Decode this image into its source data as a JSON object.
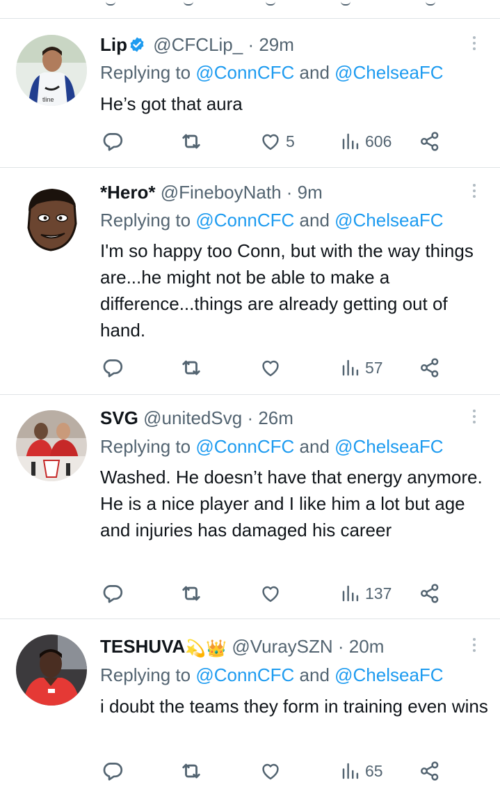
{
  "tweets": [
    {
      "name": "Lip",
      "verified": true,
      "handle": "@CFCLip_",
      "time": "· 29m",
      "replying_prefix": "Replying to ",
      "mention1": "@ConnCFC",
      "and": " and ",
      "mention2": "@ChelseaFC",
      "text": "He’s got that aura",
      "likes": "5",
      "views": "606"
    },
    {
      "name": "*Hero*",
      "verified": false,
      "handle": "@FineboyNath",
      "time": "· 9m",
      "replying_prefix": "Replying to ",
      "mention1": "@ConnCFC",
      "and": " and ",
      "mention2": "@ChelseaFC",
      "text": "I'm so happy too Conn, but with the way things are...he might not be able to make a difference...things are already getting out of hand.",
      "likes": "",
      "views": "57"
    },
    {
      "name": "SVG",
      "verified": false,
      "handle": "@unitedSvg",
      "time": "· 26m",
      "replying_prefix": "Replying to ",
      "mention1": "@ConnCFC",
      "and": " and ",
      "mention2": "@ChelseaFC",
      "text": "Washed. He doesn’t have that energy anymore. He is a nice player and I like him a lot but age and injuries has damaged his career",
      "likes": "",
      "views": "137"
    },
    {
      "name": "TESHUVA",
      "name_emojis": "💫👑",
      "verified": false,
      "handle": "@VuraySZN",
      "time": "· 20m",
      "replying_prefix": "Replying to ",
      "mention1": "@ConnCFC",
      "and": " and ",
      "mention2": "@ChelseaFC",
      "text": "i doubt the teams they form in training even wins",
      "likes": "",
      "views": "65"
    }
  ],
  "colors": {
    "text": "#0f1419",
    "secondary": "#536471",
    "link": "#1d9bf0",
    "verified": "#1d9bf0",
    "divider": "#dfe3e6"
  },
  "icons": [
    "reply-icon",
    "retweet-icon",
    "like-icon",
    "views-icon",
    "share-icon",
    "more-icon",
    "verified-badge-icon"
  ]
}
